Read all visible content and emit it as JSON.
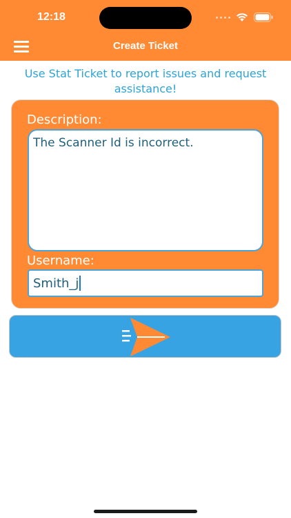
{
  "status_bar": {
    "time": "12:18"
  },
  "nav": {
    "title": "Create Ticket"
  },
  "intro": {
    "text": "Use Stat Ticket to report issues and request assistance!"
  },
  "form": {
    "description_label": "Description:",
    "description_value": "The Scanner Id is incorrect.",
    "username_label": "Username:",
    "username_value": "Smith_j"
  },
  "submit": {
    "icon": "send-icon"
  },
  "colors": {
    "header": "#ff8a33",
    "card": "#ff8a33",
    "accent_blue": "#37a3e2",
    "intro_text": "#2ea3d6",
    "field_text": "#1f5f7a"
  }
}
